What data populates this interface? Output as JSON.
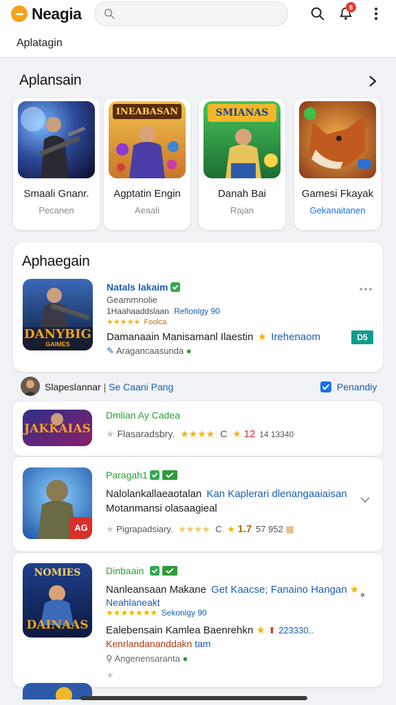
{
  "app": {
    "name": "Neagia"
  },
  "search": {
    "placeholder": ""
  },
  "header": {
    "notification_count": "8",
    "subtab": "Aplatagin"
  },
  "featured": {
    "title": "Aplansain",
    "cards": [
      {
        "name": "Smaali Gnanr.",
        "sub": "Pecanen",
        "sub_link": false,
        "banner": ""
      },
      {
        "name": "Agptatin Engin",
        "sub": "Aeaali",
        "sub_link": false,
        "banner": "INEABASAN"
      },
      {
        "name": "Danah Bai",
        "sub": "Rajan",
        "sub_link": false,
        "banner": "SMIANAS"
      },
      {
        "name": "Gamesi Fkayak",
        "sub": "Gekanaitanen",
        "sub_link": true,
        "banner": ""
      }
    ]
  },
  "panel": {
    "title": "Aphaegain",
    "item": {
      "art_text_1": "DANYBIG",
      "art_text_2": "GAIMES",
      "name": "Natals lakaim",
      "developer": "Geammnolie",
      "meta_prefix": "1Haahaaddslaan",
      "meta_link": "Refionlgy 90",
      "rating_text": "Foolca",
      "desc_1": "Damanaain Manisamanl Ilaestin",
      "desc_link": "Irehenaom",
      "footer": "Aragancaasunda",
      "action": "D5"
    }
  },
  "filter": {
    "label": "Slapeslannar",
    "sub": "Se Caani Pang",
    "check_label": "Penandiy"
  },
  "list": [
    {
      "art_text": "JAKKAIAS",
      "title": "Dmlian Ay Cadea",
      "badges": [],
      "meta": "Flasaradsbry.",
      "rating": "12",
      "count": "14 13340"
    },
    {
      "art_text": "AG",
      "title": "Paragah1",
      "badges": [
        "check",
        "tag"
      ],
      "line1": "Nalolankallaeaotalan",
      "line1_link": "Kan Kaplerari dlenangaaiaisan",
      "line2": "Motanmansi olasaagieal",
      "meta": "Pigrapadsiary.",
      "rating": "1.7",
      "count": "57 952"
    },
    {
      "art_text_1": "NOMIES",
      "art_text_2": "DAINAAS",
      "title": "Dinbaain",
      "badges": [
        "check",
        "tag"
      ],
      "line1": "Nanleansaan Makane",
      "line1_link": "Get Kaacse; Fanaino Hangan",
      "line2": "Neahlaneakt",
      "meta_link": "Sekonlgy 90",
      "line3": "Ealebensain Kamlea Baenrehkn",
      "count_red": "223330..",
      "line4": "Kenrlandananddakn",
      "line4_tail": "tam",
      "footer": "Angenensaranta"
    }
  ],
  "colors": {
    "accent": "#1a73e8",
    "brand": "#f4a21b",
    "badge_red": "#e53935",
    "green": "#2e9b3a",
    "star": "#f5b400"
  }
}
